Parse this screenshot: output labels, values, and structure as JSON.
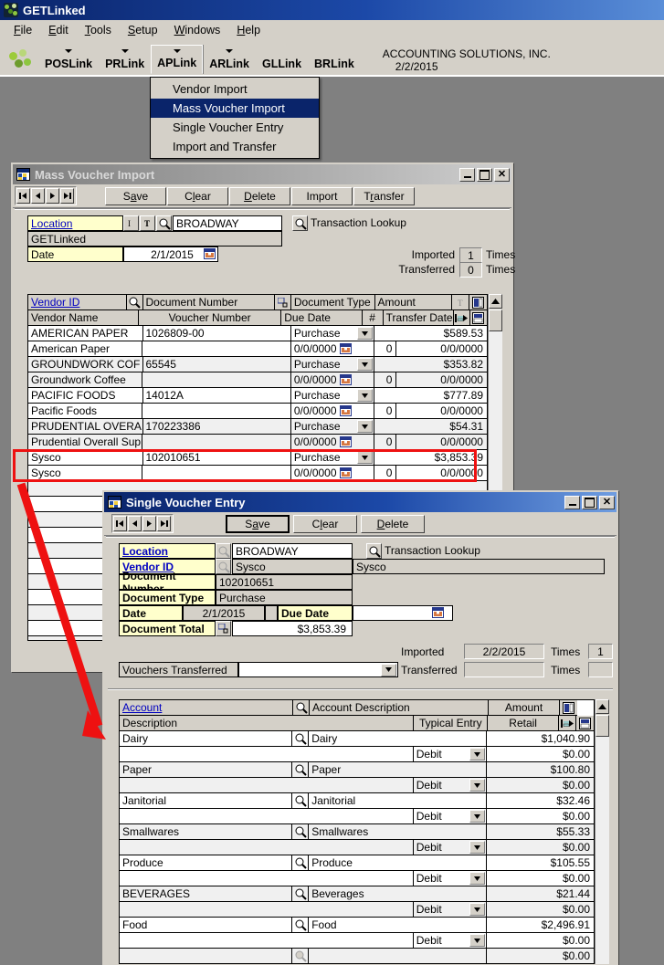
{
  "app": {
    "title": "GETLinked",
    "logo_icon": "getlinked-logo-icon",
    "menus": [
      "File",
      "Edit",
      "Tools",
      "Setup",
      "Windows",
      "Help"
    ],
    "toolbar_items": [
      "POSLink",
      "PRLink",
      "APLink",
      "ARLink",
      "GLLink",
      "BRLink"
    ],
    "company_name": "ACCOUNTING  SOLUTIONS, INC.",
    "company_date": "2/2/2015"
  },
  "dropdown": {
    "items": [
      "Vendor Import",
      "Mass Voucher Import",
      "Single Voucher Entry",
      "Import and Transfer"
    ],
    "selected": "Mass Voucher Import"
  },
  "mass_voucher": {
    "title": "Mass Voucher Import",
    "buttons": [
      "Save",
      "Clear",
      "Delete",
      "Import",
      "Transfer"
    ],
    "location_label": "Location",
    "location_value": "BROADWAY",
    "subname_value": "GETLinked",
    "date_label": "Date",
    "date_value": "2/1/2015",
    "lookup_label": "Transaction Lookup",
    "imported_label": "Imported",
    "imported_count": "1",
    "transferred_label": "Transferred",
    "transferred_count": "0",
    "times_label": "Times",
    "headers_row1": [
      "Vendor ID",
      "Document Number",
      "Document Type",
      "Amount"
    ],
    "headers_row2": [
      "Vendor Name",
      "Voucher Number",
      "Due Date",
      "#",
      "Transfer Date"
    ],
    "rows": [
      {
        "vendor_id": "AMERICAN PAPER",
        "doc_number": "1026809-00",
        "doc_type": "Purchase",
        "amount": "$589.53",
        "vendor_name": "American Paper",
        "voucher_number": "",
        "due_date": "0/0/0000",
        "num": "0",
        "transfer_date": "0/0/0000",
        "highlight": false
      },
      {
        "vendor_id": "GROUNDWORK COF",
        "doc_number": "65545",
        "doc_type": "Purchase",
        "amount": "$353.82",
        "vendor_name": "Groundwork Coffee",
        "voucher_number": "",
        "due_date": "0/0/0000",
        "num": "0",
        "transfer_date": "0/0/0000",
        "highlight": false
      },
      {
        "vendor_id": "PACIFIC FOODS",
        "doc_number": "14012A",
        "doc_type": "Purchase",
        "amount": "$777.89",
        "vendor_name": "Pacific Foods",
        "voucher_number": "",
        "due_date": "0/0/0000",
        "num": "0",
        "transfer_date": "0/0/0000",
        "highlight": false
      },
      {
        "vendor_id": "PRUDENTIAL OVERA",
        "doc_number": "170223386",
        "doc_type": "Purchase",
        "amount": "$54.31",
        "vendor_name": "Prudential Overall Supp",
        "voucher_number": "",
        "due_date": "0/0/0000",
        "num": "0",
        "transfer_date": "0/0/0000",
        "highlight": false
      },
      {
        "vendor_id": "Sysco",
        "doc_number": "102010651",
        "doc_type": "Purchase",
        "amount": "$3,853.39",
        "vendor_name": "Sysco",
        "voucher_number": "",
        "due_date": "0/0/0000",
        "num": "0",
        "transfer_date": "0/0/0000",
        "highlight": true
      }
    ]
  },
  "single_voucher": {
    "title": "Single Voucher Entry",
    "buttons": [
      "Save",
      "Clear",
      "Delete"
    ],
    "fields": [
      {
        "label": "Location",
        "value": "BROADWAY"
      },
      {
        "label": "Vendor ID",
        "value": "Sysco"
      },
      {
        "label": "Document Number",
        "value": "102010651"
      },
      {
        "label": "Document Type",
        "value": "Purchase"
      }
    ],
    "vendor_name": "Sysco",
    "lookup_label": "Transaction Lookup",
    "date_label": "Date",
    "date_value": "2/1/2015",
    "due_date_label": "Due Date",
    "due_date_value": "",
    "doc_total_label": "Document Total",
    "doc_total_value": "$3,853.39",
    "imported_label": "Imported",
    "imported_date": "2/2/2015",
    "imported_times_label": "Times",
    "imported_times": "1",
    "transferred_label": "Transferred",
    "transferred_date": "",
    "transferred_times_label": "Times",
    "transferred_times": "",
    "vouchers_transferred_label": "Vouchers Transferred",
    "vouchers_transferred_value": "",
    "headers_row1": [
      "Account",
      "Account Description",
      "Amount"
    ],
    "headers_row2": [
      "Description",
      "Typical Entry",
      "Retail"
    ],
    "rows": [
      {
        "account": "Dairy",
        "account_description": "Dairy",
        "amount": "$1,040.90",
        "description": "",
        "typical_entry": "Debit",
        "retail": "$0.00"
      },
      {
        "account": "Paper",
        "account_description": "Paper",
        "amount": "$100.80",
        "description": "",
        "typical_entry": "Debit",
        "retail": "$0.00"
      },
      {
        "account": "Janitorial",
        "account_description": "Janitorial",
        "amount": "$32.46",
        "description": "",
        "typical_entry": "Debit",
        "retail": "$0.00"
      },
      {
        "account": "Smallwares",
        "account_description": "Smallwares",
        "amount": "$55.33",
        "description": "",
        "typical_entry": "Debit",
        "retail": "$0.00"
      },
      {
        "account": "Produce",
        "account_description": "Produce",
        "amount": "$105.55",
        "description": "",
        "typical_entry": "Debit",
        "retail": "$0.00"
      },
      {
        "account": "BEVERAGES",
        "account_description": "Beverages",
        "amount": "$21.44",
        "description": "",
        "typical_entry": "Debit",
        "retail": "$0.00"
      },
      {
        "account": "Food",
        "account_description": "Food",
        "amount": "$2,496.91",
        "description": "",
        "typical_entry": "Debit",
        "retail": "$0.00"
      },
      {
        "account": "",
        "account_description": "",
        "amount": "$0.00",
        "description": "",
        "typical_entry": "",
        "retail": ""
      }
    ]
  },
  "annotation": {
    "highlight_color": "#ee1111",
    "arrow_from": "sysco-row",
    "arrow_to": "dairy-row"
  }
}
